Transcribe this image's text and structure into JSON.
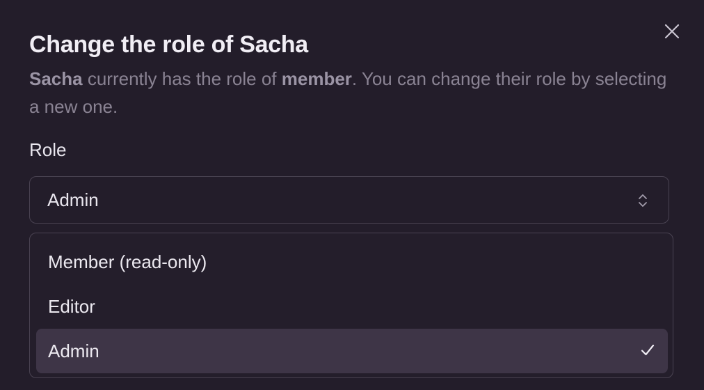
{
  "dialog": {
    "title": "Change the role of Sacha",
    "description": {
      "name": "Sacha",
      "text1": " currently has the role of ",
      "current_role": "member",
      "text2": ". You can change their role by selecting a new one."
    },
    "close_icon": "close-icon"
  },
  "role_field": {
    "label": "Role",
    "selected_value": "Admin",
    "chevron_icon": "chevron-up-down-icon"
  },
  "role_options": [
    {
      "label": "Member (read-only)",
      "selected": false
    },
    {
      "label": "Editor",
      "selected": false
    },
    {
      "label": "Admin",
      "selected": true
    }
  ],
  "colors": {
    "background": "#231d2a",
    "border": "#4a4352",
    "selected_option_bg": "#3e3547",
    "muted_text": "#8a8393"
  }
}
